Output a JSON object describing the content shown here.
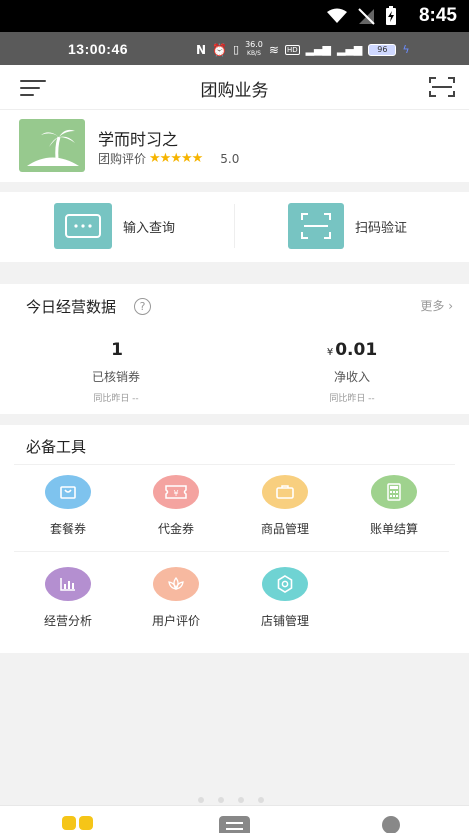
{
  "system_status": {
    "time": "8:45"
  },
  "app_status": {
    "time": "13:00:46",
    "network_speed": "36.0",
    "network_unit": "KB/S",
    "hd": "HD",
    "battery": "96"
  },
  "nav": {
    "title": "团购业务"
  },
  "store": {
    "name": "学而时习之",
    "rating_label": "团购评价",
    "stars": 5,
    "score": "5.0"
  },
  "actions": [
    {
      "label": "输入查询",
      "icon": "keyboard-icon"
    },
    {
      "label": "扫码验证",
      "icon": "scan-icon"
    }
  ],
  "stats": {
    "title": "今日经营数据",
    "more": "更多",
    "items": [
      {
        "prefix": "",
        "value": "1",
        "label": "已核销券",
        "compare": "同比昨日 --"
      },
      {
        "prefix": "¥",
        "value": "0.01",
        "label": "净收入",
        "compare": "同比昨日 --"
      }
    ]
  },
  "tools": {
    "title": "必备工具",
    "items": [
      {
        "label": "套餐券",
        "icon": "bag-icon",
        "color": "#7ec3ee"
      },
      {
        "label": "代金券",
        "icon": "voucher-icon",
        "color": "#f4a3a0"
      },
      {
        "label": "商品管理",
        "icon": "briefcase-icon",
        "color": "#f8cf7f"
      },
      {
        "label": "账单结算",
        "icon": "calculator-icon",
        "color": "#9fd28e"
      },
      {
        "label": "经营分析",
        "icon": "bar-chart-icon",
        "color": "#b48fd0"
      },
      {
        "label": "用户评价",
        "icon": "lotus-icon",
        "color": "#f7b9a0"
      },
      {
        "label": "店铺管理",
        "icon": "gear-icon",
        "color": "#6fd3d3"
      }
    ]
  },
  "colors": {
    "accent": "#77c4c2",
    "star": "#f6b400",
    "tab_active": "#f5c518"
  }
}
